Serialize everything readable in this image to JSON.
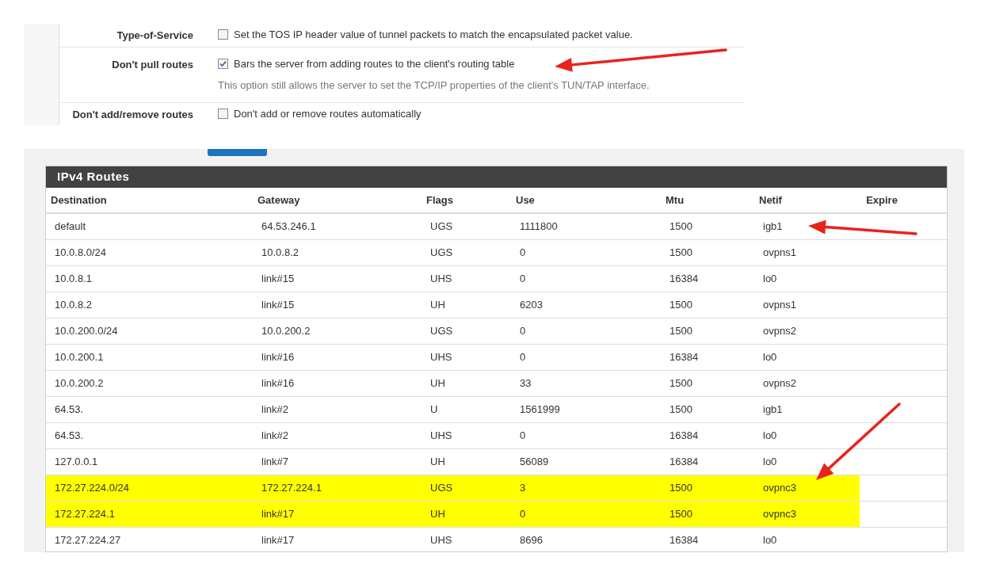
{
  "settings": [
    {
      "label": "Type-of-Service",
      "checked": false,
      "text": "Set the TOS IP header value of tunnel packets to match the encapsulated packet value."
    },
    {
      "label": "Don't pull routes",
      "checked": true,
      "text": "Bars the server from adding routes to the client's routing table",
      "help": "This option still allows the server to set the TCP/IP properties of the client's TUN/TAP interface."
    },
    {
      "label": "Don't add/remove routes",
      "checked": false,
      "text": "Don't add or remove routes automatically"
    }
  ],
  "routes": {
    "title": "IPv4 Routes",
    "columns": [
      "Destination",
      "Gateway",
      "Flags",
      "Use",
      "Mtu",
      "Netif",
      "Expire"
    ],
    "rows": [
      {
        "cells": [
          "default",
          "64.53.246.1",
          "UGS",
          "1111800",
          "1500",
          "igb1"
        ],
        "highlighted": false
      },
      {
        "cells": [
          "10.0.8.0/24",
          "10.0.8.2",
          "UGS",
          "0",
          "1500",
          "ovpns1"
        ],
        "highlighted": false
      },
      {
        "cells": [
          "10.0.8.1",
          "link#15",
          "UHS",
          "0",
          "16384",
          "lo0"
        ],
        "highlighted": false
      },
      {
        "cells": [
          "10.0.8.2",
          "link#15",
          "UH",
          "6203",
          "1500",
          "ovpns1"
        ],
        "highlighted": false
      },
      {
        "cells": [
          "10.0.200.0/24",
          "10.0.200.2",
          "UGS",
          "0",
          "1500",
          "ovpns2"
        ],
        "highlighted": false
      },
      {
        "cells": [
          "10.0.200.1",
          "link#16",
          "UHS",
          "0",
          "16384",
          "lo0"
        ],
        "highlighted": false
      },
      {
        "cells": [
          "10.0.200.2",
          "link#16",
          "UH",
          "33",
          "1500",
          "ovpns2"
        ],
        "highlighted": false
      },
      {
        "cells": [
          "64.53.",
          "link#2",
          "U",
          "1561999",
          "1500",
          "igb1"
        ],
        "highlighted": false
      },
      {
        "cells": [
          "64.53.",
          "link#2",
          "UHS",
          "0",
          "16384",
          "lo0"
        ],
        "highlighted": false
      },
      {
        "cells": [
          "127.0.0.1",
          "link#7",
          "UH",
          "56089",
          "16384",
          "lo0"
        ],
        "highlighted": false
      },
      {
        "cells": [
          "172.27.224.0/24",
          "172.27.224.1",
          "UGS",
          "3",
          "1500",
          "ovpnc3"
        ],
        "highlighted": true
      },
      {
        "cells": [
          "172.27.224.1",
          "link#17",
          "UH",
          "0",
          "1500",
          "ovpnc3"
        ],
        "highlighted": true
      },
      {
        "cells": [
          "172.27.224.27",
          "link#17",
          "UHS",
          "8696",
          "16384",
          "lo0"
        ],
        "highlighted": false
      }
    ]
  }
}
